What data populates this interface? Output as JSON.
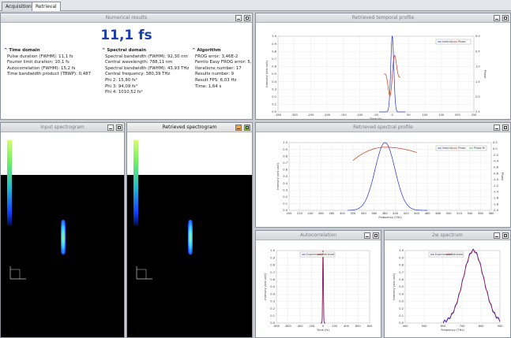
{
  "tabs": [
    {
      "label": "Acquisition",
      "active": false
    },
    {
      "label": "Retrieval",
      "active": true
    }
  ],
  "numerical": {
    "title": "Numerical results",
    "big_value": "11,1 fs",
    "time_domain": {
      "heading": "Time domain",
      "lines": [
        "Pulse duration (FWHM): 11,1 fs",
        "Fourier limit duration: 10,1 fs",
        "Autocorrelation (FWHM): 15,2 fs",
        "Time bandwidth product (TBWP): 0,487"
      ]
    },
    "spectral_domain": {
      "heading": "Spectral domain",
      "lines": [
        "Spectral bandwidth (FWHM): 92,30 nm",
        "Central wavelength: 788,11 nm",
        "Spectral bandwidth (FWHM): 43,93 THz",
        "Central frequency: 380,39 THz",
        "Phi 2:   15,80 fs²",
        "Phi 3: 94,09 fs³",
        "Phi 4: 1010,52 fs⁴"
      ]
    },
    "algorithm": {
      "heading": "Algorithm",
      "lines": [
        "FROG error: 3,46E-2",
        "Femto Easy FROG error: 5,",
        "Iterations number: 17",
        "Results number: 9",
        "Result FPS: 6,03 Hz",
        "Time: 1,64 s"
      ]
    }
  },
  "temporal": {
    "title": "Retrieved temporal profile",
    "xlabel": "Time (fs)",
    "ylabel": "Intensity (arb.unit)",
    "y2label": "Phase",
    "legend": [
      "Intensity",
      "Phase"
    ],
    "xticks": [
      "-350",
      "-300",
      "-250",
      "-200",
      "-150",
      "-100",
      "-50",
      "0",
      "50",
      "100",
      "150",
      "200",
      "250"
    ],
    "yticks": [
      "0.0",
      "0.1",
      "0.2",
      "0.3",
      "0.4",
      "0.5",
      "0.6",
      "0.7",
      "0.8",
      "0.9",
      "1.0"
    ],
    "y2ticks": [
      "0.0",
      "0.5",
      "1.0",
      "1.5",
      "2.0",
      "2.5"
    ]
  },
  "input_spec": {
    "title": "Input spectrogram"
  },
  "retrieved_spec": {
    "title": "Retrieved spectrogram"
  },
  "spectral": {
    "title": "Retrieved spectral profile",
    "xlabel": "Frequency (THz)",
    "ylabel": "Intensity (arb.unit)",
    "y2label": "Phase",
    "legend": [
      "Intensity",
      "Phase",
      "Phase fit"
    ],
    "xticks": [
      "200",
      "220",
      "240",
      "260",
      "280",
      "300",
      "320",
      "340",
      "360",
      "380",
      "400",
      "420",
      "440",
      "460",
      "480",
      "500",
      "520",
      "540",
      "560",
      "580"
    ],
    "yticks": [
      "0.0",
      "0.1",
      "0.2",
      "0.3",
      "0.4",
      "0.5",
      "0.6",
      "0.7",
      "0.8",
      "0.9",
      "1.0"
    ],
    "y2ticks": [
      "0.2",
      "0.0",
      "-0.2",
      "-0.4",
      "-0.6",
      "-0.8",
      "-1.0",
      "-1.2",
      "-1.4",
      "-1.6",
      "-1.8",
      "-2.0"
    ]
  },
  "autocorr": {
    "title": "Autocorrelation",
    "xlabel": "Time (fs)",
    "ylabel": "Intensity (arb.unit)",
    "legend": [
      "Experimental",
      "Retrieved"
    ],
    "xticks": [
      "-800",
      "-600",
      "-400",
      "-200",
      "0",
      "200",
      "400",
      "600",
      "800"
    ],
    "yticks": [
      "0.0",
      "0.1",
      "0.2",
      "0.3",
      "0.4",
      "0.5",
      "0.6",
      "0.7",
      "0.8",
      "0.9",
      "1.0"
    ]
  },
  "shg": {
    "title": "2w spectrum",
    "xlabel": "Frequency (THz)",
    "ylabel": "Intensity (arb.unit)",
    "legend": [
      "Experimental",
      "Retrieved"
    ],
    "xticks": [
      "400",
      "500",
      "600",
      "700",
      "800",
      "900"
    ],
    "yticks": [
      "0.0",
      "0.1",
      "0.2",
      "0.3",
      "0.4",
      "0.5",
      "0.6",
      "0.7",
      "0.8",
      "0.9",
      "1.0"
    ]
  },
  "colors": {
    "intensity": "#2233cc",
    "phase": "#cc3311",
    "phase_fit": "#22aa33",
    "experimental": "#2233cc",
    "retrieved": "#cc1133"
  }
}
